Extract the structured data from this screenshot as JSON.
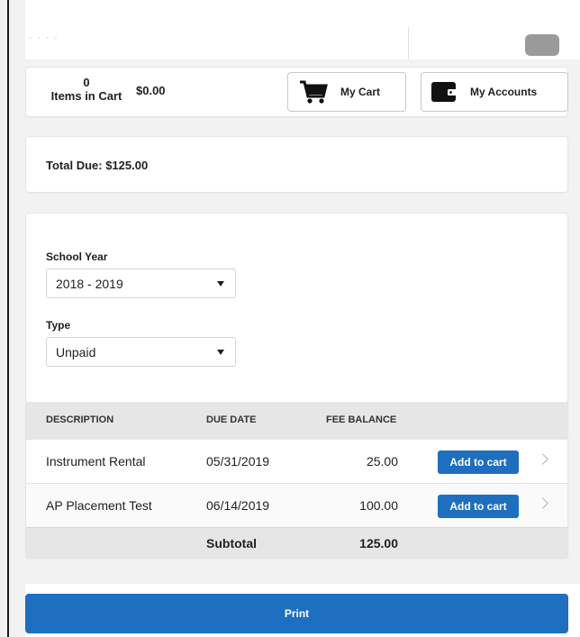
{
  "header": {
    "faint_text": "· · · ·"
  },
  "cart": {
    "items_count": "0",
    "items_label": "Items in Cart",
    "total": "$0.00",
    "my_cart_label": "My Cart",
    "my_accounts_label": "My Accounts"
  },
  "summary": {
    "total_due": "Total Due: $125.00"
  },
  "filters": {
    "school_year_label": "School Year",
    "school_year_value": "2018 - 2019",
    "type_label": "Type",
    "type_value": "Unpaid"
  },
  "table": {
    "headers": {
      "description": "DESCRIPTION",
      "due_date": "DUE DATE",
      "fee_balance": "FEE BALANCE"
    },
    "rows": [
      {
        "description": "Instrument Rental",
        "due_date": "05/31/2019",
        "balance": "25.00",
        "action": "Add to cart"
      },
      {
        "description": "AP Placement Test",
        "due_date": "06/14/2019",
        "balance": "100.00",
        "action": "Add to cart"
      }
    ],
    "subtotal_label": "Subtotal",
    "subtotal_value": "125.00"
  },
  "actions": {
    "print_label": "Print"
  },
  "colors": {
    "primary": "#1e6fc0",
    "table_header": "#e6e6e6",
    "background": "#f2f2f2"
  }
}
